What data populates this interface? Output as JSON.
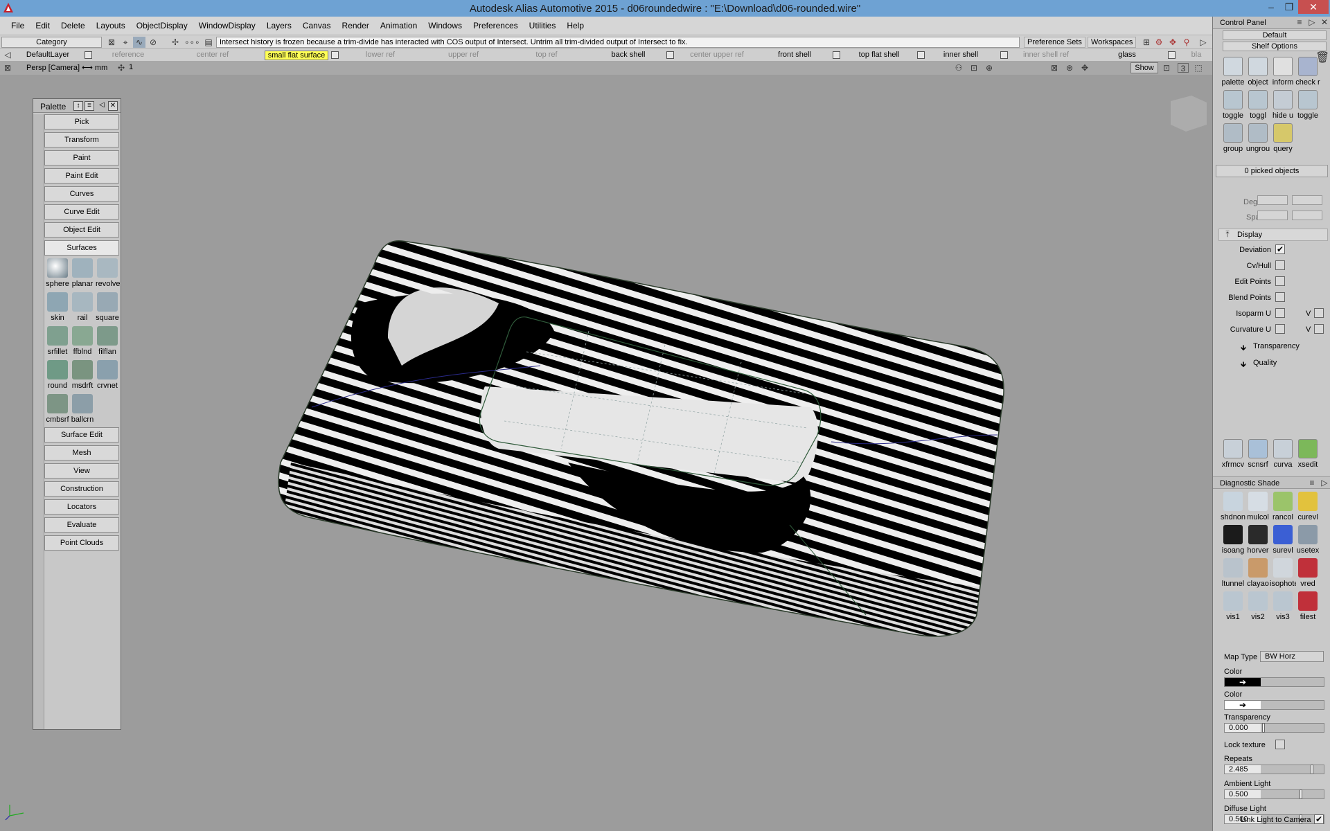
{
  "window": {
    "title": "Autodesk Alias Automotive 2015      - d06roundedwire : \"E:\\Download\\d06-rounded.wire\"",
    "controls": [
      "–",
      "❐",
      "✕"
    ]
  },
  "menu": [
    "File",
    "Edit",
    "Delete",
    "Layouts",
    "ObjectDisplay",
    "WindowDisplay",
    "Layers",
    "Canvas",
    "Render",
    "Animation",
    "Windows",
    "Preferences",
    "Utilities",
    "Help"
  ],
  "shelfbar": {
    "category": "Category",
    "message": "Intersect history is frozen because a trim-divide has interacted with COS output of Intersect.  Untrim all trim-divided output of Intersect to fix.",
    "preference_sets": "Preference Sets",
    "workspaces": "Workspaces"
  },
  "layers": [
    {
      "name": "DefaultLayer",
      "state": "normal"
    },
    {
      "name": "reference",
      "state": "dim"
    },
    {
      "name": "center ref",
      "state": "dim"
    },
    {
      "name": "small flat surface",
      "state": "selected"
    },
    {
      "name": "lower ref",
      "state": "dim"
    },
    {
      "name": "upper ref",
      "state": "dim"
    },
    {
      "name": "top ref",
      "state": "dim"
    },
    {
      "name": "back shell",
      "state": "normal"
    },
    {
      "name": "center upper ref",
      "state": "dim"
    },
    {
      "name": "front shell",
      "state": "normal"
    },
    {
      "name": "top flat shell",
      "state": "normal"
    },
    {
      "name": "inner shell",
      "state": "normal"
    },
    {
      "name": "inner shell ref",
      "state": "dim"
    },
    {
      "name": "glass",
      "state": "normal"
    },
    {
      "name": "bla",
      "state": "dim"
    }
  ],
  "viewport": {
    "label": "Persp [Camera] ⟷ mm",
    "frame": "1",
    "show": "Show",
    "count": "3"
  },
  "palette": {
    "title": "Palette",
    "buttons_top": [
      "Pick",
      "Transform",
      "Paint",
      "Paint Edit",
      "Curves",
      "Curve Edit",
      "Object Edit",
      "Surfaces"
    ],
    "tools": [
      {
        "label": "sphere",
        "icon": "sphere-icon",
        "color": "#b8c6cf"
      },
      {
        "label": "planar",
        "icon": "planar-icon",
        "color": "#9fb2bd"
      },
      {
        "label": "revolve",
        "icon": "revolve-icon",
        "color": "#a9b8c1"
      },
      {
        "label": "skin",
        "icon": "skin-icon",
        "color": "#8ea6b3"
      },
      {
        "label": "rail",
        "icon": "rail-icon",
        "color": "#a7b7c0"
      },
      {
        "label": "square",
        "icon": "square-icon",
        "color": "#98a9b4"
      },
      {
        "label": "srfillet",
        "icon": "srfillet-icon",
        "color": "#7fa08f"
      },
      {
        "label": "ffblnd",
        "icon": "ffblnd-icon",
        "color": "#89a892"
      },
      {
        "label": "filflan",
        "icon": "filflan-icon",
        "color": "#7d9a8a"
      },
      {
        "label": "round",
        "icon": "round-icon",
        "color": "#6f9a86"
      },
      {
        "label": "msdrft",
        "icon": "msdrft-icon",
        "color": "#7a9480"
      },
      {
        "label": "crvnet",
        "icon": "crvnet-icon",
        "color": "#8aa0ad"
      },
      {
        "label": "cmbsrf",
        "icon": "cmbsrf-icon",
        "color": "#7d9585"
      },
      {
        "label": "ballcrn",
        "icon": "ballcrn-icon",
        "color": "#8c9ea8"
      }
    ],
    "buttons_bottom": [
      "Surface Edit",
      "Mesh",
      "View",
      "Construction",
      "Locators",
      "Evaluate",
      "Point Clouds"
    ]
  },
  "control_panel": {
    "title": "Control Panel",
    "default": "Default",
    "shelf_options": "Shelf Options",
    "shelf": [
      {
        "label": "palette",
        "icon": "palette-icon"
      },
      {
        "label": "object",
        "icon": "object-icon"
      },
      {
        "label": "inform",
        "icon": "info-icon"
      },
      {
        "label": "check r",
        "icon": "check-icon"
      },
      {
        "label": "toggle",
        "icon": "toggle-icon"
      },
      {
        "label": "toggl",
        "icon": "toggle-icon"
      },
      {
        "label": "hide u",
        "icon": "hide-icon"
      },
      {
        "label": "toggle",
        "icon": "toggle-icon"
      },
      {
        "label": "group",
        "icon": "group-icon"
      },
      {
        "label": "ungrou",
        "icon": "ungroup-icon"
      },
      {
        "label": "query",
        "icon": "query-icon"
      }
    ],
    "picked": "0 picked objects",
    "degree": "Degree",
    "spans": "Spans",
    "display_section": "Display",
    "display_options": [
      {
        "label": "Deviation",
        "checked": true
      },
      {
        "label": "Cv/Hull",
        "checked": false
      },
      {
        "label": "Edit Points",
        "checked": false
      },
      {
        "label": "Blend Points",
        "checked": false
      },
      {
        "label": "Isoparm U",
        "checked": false,
        "v": true
      },
      {
        "label": "Curvature U",
        "checked": false,
        "v": true
      }
    ],
    "v_label": "V",
    "transparency_sub": "Transparency",
    "quality_sub": "Quality",
    "tools_row": [
      {
        "label": "xfrmcv",
        "icon": "xfrmcv-icon"
      },
      {
        "label": "scnsrf",
        "icon": "scnsrf-icon"
      },
      {
        "label": "curva",
        "icon": "curvature-icon"
      },
      {
        "label": "xsedit",
        "icon": "xsedit-icon"
      }
    ],
    "diag_title": "Diagnostic Shade",
    "diag_tools": [
      {
        "label": "shdnon",
        "icon": "shade-off-icon",
        "color": "#c8d4de"
      },
      {
        "label": "mulcol",
        "icon": "multicolor-icon",
        "color": "#d6dde4"
      },
      {
        "label": "rancol",
        "icon": "random-color-icon",
        "color": "#9bc46a"
      },
      {
        "label": "curevl",
        "icon": "curve-eval-icon",
        "color": "#e2c23d"
      },
      {
        "label": "isoang",
        "icon": "isoangle-icon",
        "color": "#1b1b1b"
      },
      {
        "label": "horver",
        "icon": "horver-icon",
        "color": "#2a2a2a"
      },
      {
        "label": "surevl",
        "icon": "surface-eval-icon",
        "color": "#3b5fd4"
      },
      {
        "label": "usetex",
        "icon": "texture-icon",
        "color": "#8b9aa8"
      },
      {
        "label": "ltunnel",
        "icon": "light-tunnel-icon",
        "color": "#b9c3cc"
      },
      {
        "label": "clayao",
        "icon": "clay-icon",
        "color": "#c99a6a"
      },
      {
        "label": "isophote",
        "icon": "isophote-icon",
        "color": "#d0d6dc"
      },
      {
        "label": "vred",
        "icon": "vred-icon",
        "color": "#c0303a"
      },
      {
        "label": "vis1",
        "icon": "vis1-icon",
        "color": "#bac6d0"
      },
      {
        "label": "vis2",
        "icon": "vis2-icon",
        "color": "#bac6d0"
      },
      {
        "label": "vis3",
        "icon": "vis3-icon",
        "color": "#bac6d0"
      },
      {
        "label": "filest",
        "icon": "file-state-icon",
        "color": "#c0303a"
      }
    ],
    "map_type_label": "Map Type",
    "map_type": "BW Horz",
    "color1_label": "Color",
    "color2_label": "Color",
    "transparency_label": "Transparency",
    "transparency_value": "0.000",
    "lock_texture": "Lock texture",
    "repeats_label": "Repeats",
    "repeats_value": "2.485",
    "ambient_label": "Ambient Light",
    "ambient_value": "0.500",
    "diffuse_label": "Diffuse Light",
    "diffuse_value": "0.500",
    "link_light": "Link Light to Camera"
  }
}
